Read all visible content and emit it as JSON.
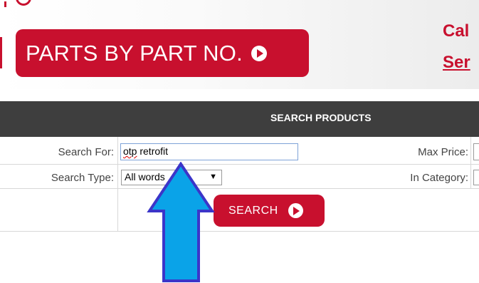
{
  "header": {
    "parts_button_label": "PARTS BY PART NO.",
    "call_text": "Cal",
    "service_link": "Ser"
  },
  "search_panel": {
    "title": "SEARCH PRODUCTS",
    "search_for_label": "Search For:",
    "search_for_value_word1": "otp",
    "search_for_value_rest": " retrofit",
    "search_type_label": "Search Type:",
    "search_type_value": "All words",
    "search_type_arrow": "▼",
    "max_price_label": "Max Price:",
    "in_category_label": "In Category:",
    "search_button_label": "SEARCH"
  },
  "colors": {
    "brand_red": "#c8102e",
    "header_bar": "#3e3e3e",
    "arrow_fill": "#0aa3e8",
    "arrow_stroke": "#3b35c9"
  },
  "icons": [
    "play-circle-icon",
    "dropdown-arrow-icon",
    "up-arrow-annotation"
  ]
}
